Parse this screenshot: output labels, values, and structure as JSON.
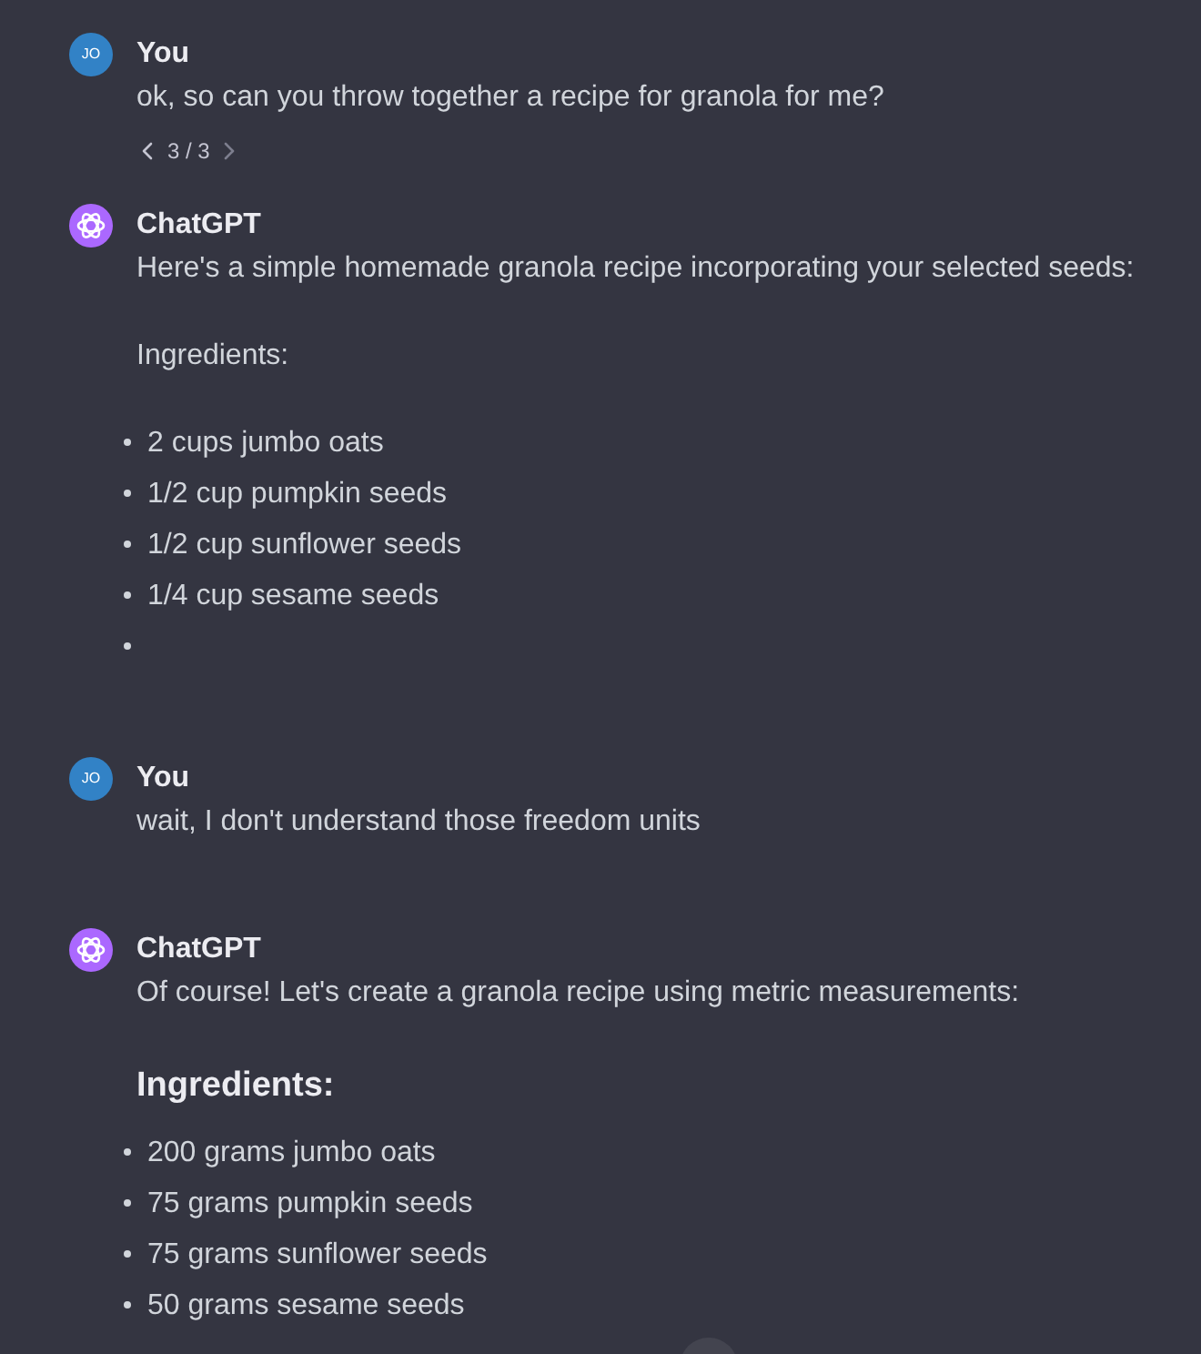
{
  "messages": [
    {
      "kind": "user",
      "author": "You",
      "avatar_initials": "JO",
      "blocks": [
        {
          "kind": "paragraph",
          "text": "ok, so can you throw together a recipe for granola for me?"
        }
      ],
      "pager": {
        "label": "3 / 3",
        "prev_disabled": false,
        "next_disabled": true
      }
    },
    {
      "kind": "assistant",
      "author": "ChatGPT",
      "blocks": [
        {
          "kind": "paragraph",
          "text": "Here's a simple homemade granola recipe incorporating your selected seeds:"
        },
        {
          "kind": "paragraph",
          "text": "Ingredients:"
        },
        {
          "kind": "list",
          "items": [
            {
              "kind": "text",
              "text": "2 cups jumbo oats"
            },
            {
              "kind": "text",
              "text": "1/2 cup pumpkin seeds"
            },
            {
              "kind": "text",
              "text": "1/2 cup sunflower seeds"
            },
            {
              "kind": "text",
              "text": "1/4 cup sesame seeds"
            },
            {
              "kind": "empty"
            }
          ]
        }
      ]
    },
    {
      "kind": "user",
      "author": "You",
      "avatar_initials": "JO",
      "blocks": [
        {
          "kind": "paragraph",
          "text": "wait, I don't understand those freedom units"
        }
      ]
    },
    {
      "kind": "assistant",
      "author": "ChatGPT",
      "blocks": [
        {
          "kind": "paragraph",
          "text": "Of course! Let's create a granola recipe using metric measurements:"
        },
        {
          "kind": "heading",
          "text": "Ingredients:"
        },
        {
          "kind": "list",
          "items": [
            {
              "kind": "text",
              "text": "200 grams jumbo oats"
            },
            {
              "kind": "text",
              "text": "75 grams pumpkin seeds"
            },
            {
              "kind": "text",
              "text": "75 grams sunflower seeds"
            },
            {
              "kind": "text",
              "text": "50 grams sesame seeds"
            }
          ]
        }
      ]
    }
  ]
}
